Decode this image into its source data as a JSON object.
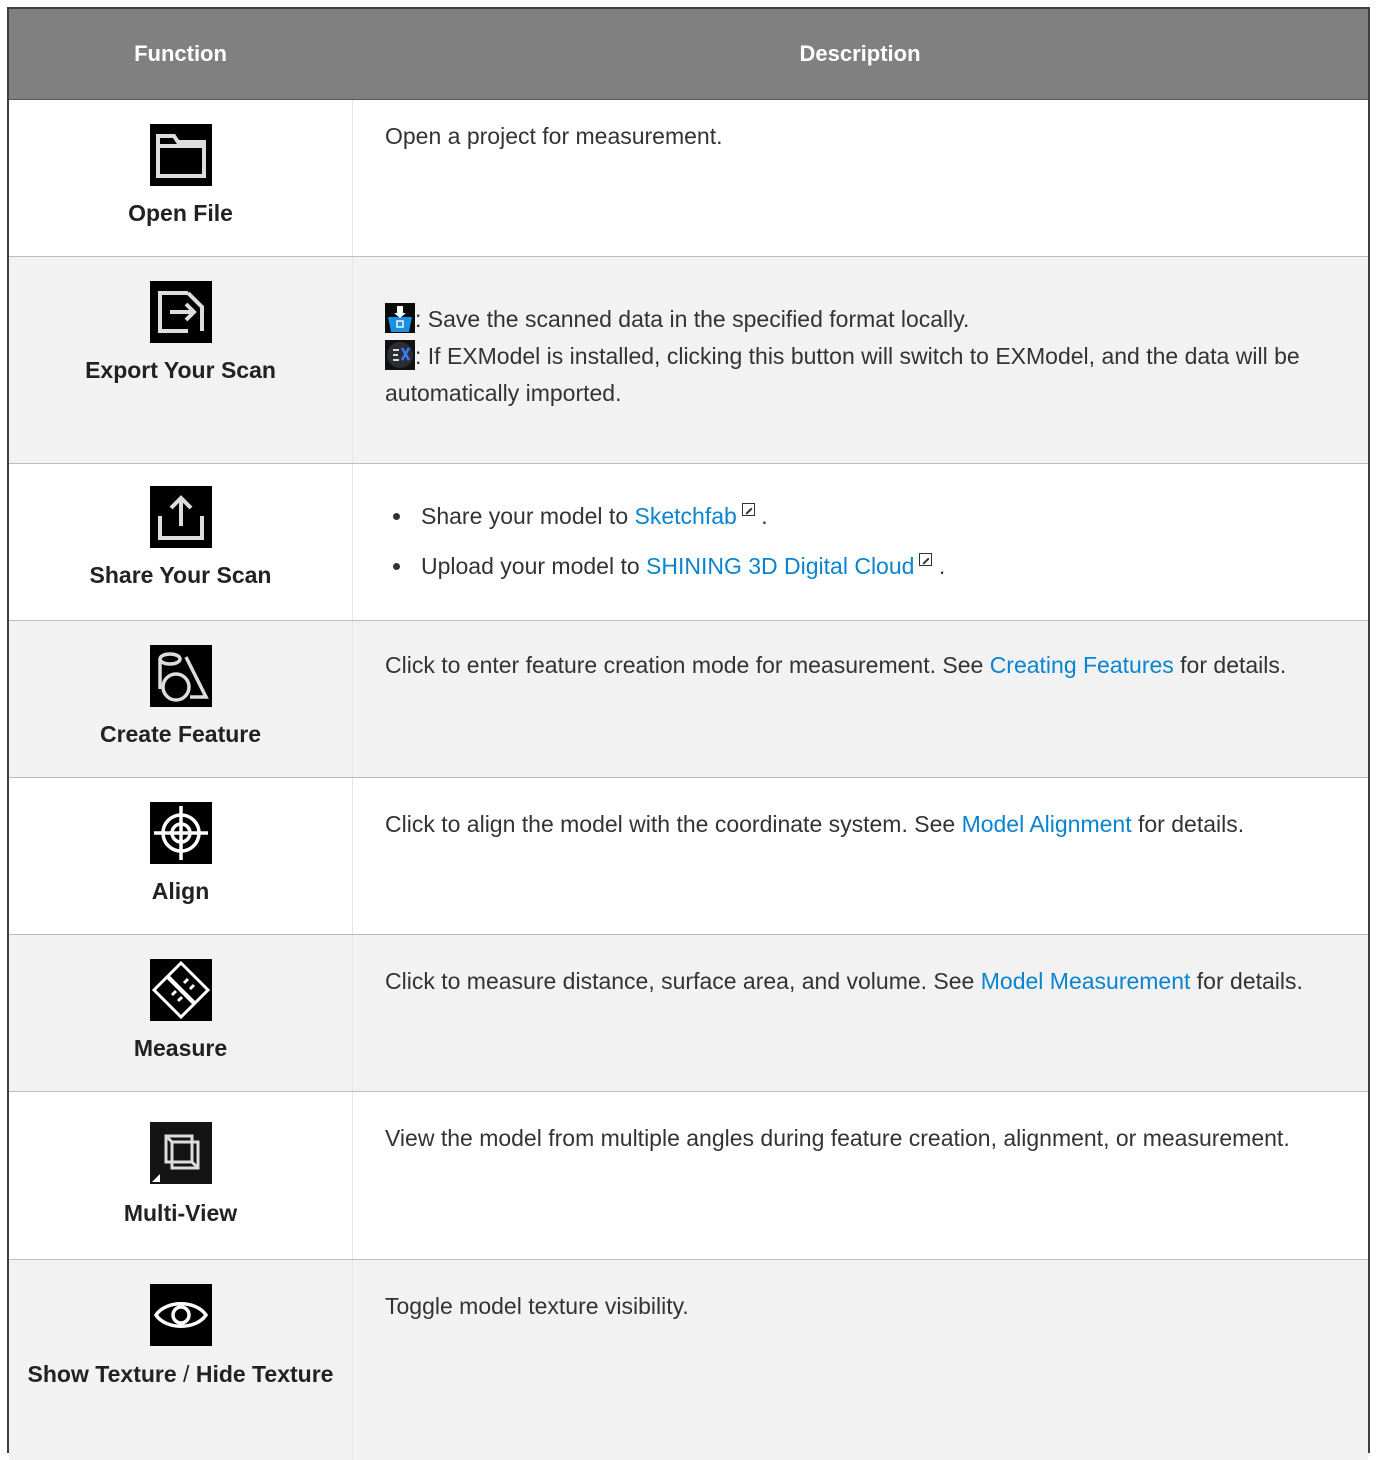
{
  "header": {
    "function": "Function",
    "description": "Description"
  },
  "rows": [
    {
      "label": "Open File",
      "icon": "folder-icon",
      "desc": "Open a project for measurement."
    },
    {
      "label": "Export Your Scan",
      "icon": "export-icon",
      "desc1": ": Save the scanned data in the specified format locally.",
      "desc2": ": If EXModel is installed, clicking this button will switch to EXModel, and the data will be automatically imported.",
      "mini1": "save-local-icon",
      "mini2": "exmodel-icon",
      "mini2_text": "Model"
    },
    {
      "label": "Share Your Scan",
      "icon": "share-icon",
      "b1_pre": "Share your model to ",
      "b1_link": "Sketchfab",
      "b1_post": ".",
      "b2_pre": "Upload your model to ",
      "b2_link": "SHINING 3D Digital Cloud",
      "b2_post": "."
    },
    {
      "label": "Create Feature",
      "icon": "create-feature-icon",
      "pre": "Click to enter feature creation mode for measurement. See ",
      "link": "Creating Features",
      "post": " for details."
    },
    {
      "label": "Align",
      "icon": "align-icon",
      "pre": "Click to align the model with the coordinate system. See ",
      "link": "Model Alignment",
      "post": " for details."
    },
    {
      "label": "Measure",
      "icon": "measure-icon",
      "pre": "Click to measure distance, surface area, and volume. See ",
      "link": "Model Measurement",
      "post": " for details."
    },
    {
      "label": "Multi-View",
      "icon": "multi-view-icon",
      "desc": "View the model from multiple angles during feature creation, alignment, or measurement."
    },
    {
      "label_a": "Show Texture",
      "label_sep": " / ",
      "label_b": "Hide Texture",
      "icon": "eye-icon",
      "desc": "Toggle model texture visibility."
    }
  ],
  "colors": {
    "header_bg": "#808080",
    "link": "#0a84d0",
    "alt_row": "#f2f2f2"
  }
}
